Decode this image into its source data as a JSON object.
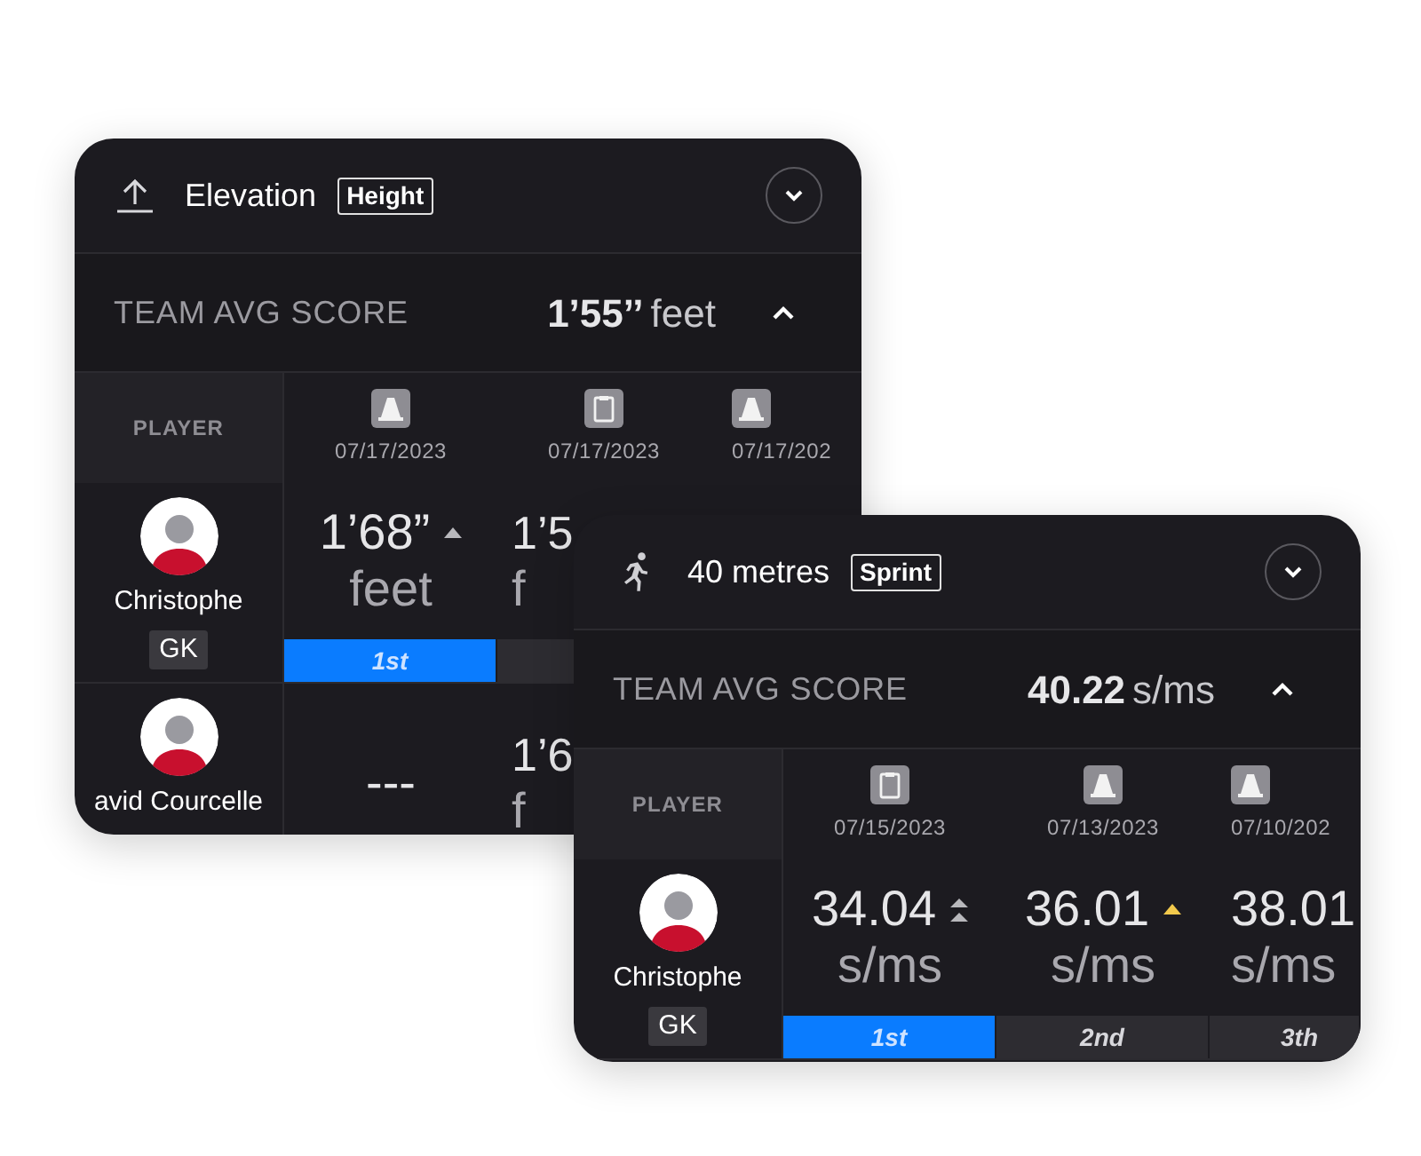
{
  "cards": [
    {
      "kind": "upload",
      "title": "Elevation",
      "tag": "Height",
      "avg_label": "TEAM AVG SCORE",
      "avg_value": "1’55’’",
      "avg_unit": "feet",
      "player_heading": "PLAYER",
      "columns": [
        {
          "kind": "cone",
          "date": "07/17/2023"
        },
        {
          "kind": "clipboard",
          "date": "07/17/2023"
        },
        {
          "kind": "cone",
          "date": "07/17/202"
        }
      ],
      "rows": [
        {
          "player": "Christophe",
          "position": "GK",
          "cells": [
            {
              "value": "1’68”",
              "unit": "feet",
              "trend": {
                "kind": "single",
                "color": "#b8b8bc"
              },
              "rank": "1st",
              "highlighted": true
            },
            {
              "value": "1’5",
              "unit": "f",
              "highlighted": false
            }
          ]
        },
        {
          "player": "avid Courcelle",
          "cells": [
            {
              "value": "---"
            },
            {
              "value": "1’6",
              "unit": "f"
            }
          ]
        }
      ]
    },
    {
      "kind": "runner",
      "title": "40 metres",
      "tag": "Sprint",
      "avg_label": "TEAM AVG SCORE",
      "avg_value": "40.22",
      "avg_unit": "s/ms",
      "player_heading": "PLAYER",
      "columns": [
        {
          "kind": "clipboard",
          "date": "07/15/2023"
        },
        {
          "kind": "cone",
          "date": "07/13/2023"
        },
        {
          "kind": "cone",
          "date": "07/10/202"
        }
      ],
      "rows": [
        {
          "player": "Christophe",
          "position": "GK",
          "cells": [
            {
              "value": "34.04",
              "unit": "s/ms",
              "trend": {
                "kind": "double",
                "color": "#b8b8bc"
              },
              "rank": "1st",
              "highlighted": true
            },
            {
              "value": "36.01",
              "unit": "s/ms",
              "trend": {
                "kind": "single",
                "color": "#f2c94c"
              },
              "rank": "2nd",
              "highlighted": false
            },
            {
              "value": "38.01",
              "unit": "s/ms",
              "rank": "3th",
              "highlighted": false
            }
          ]
        }
      ]
    }
  ]
}
